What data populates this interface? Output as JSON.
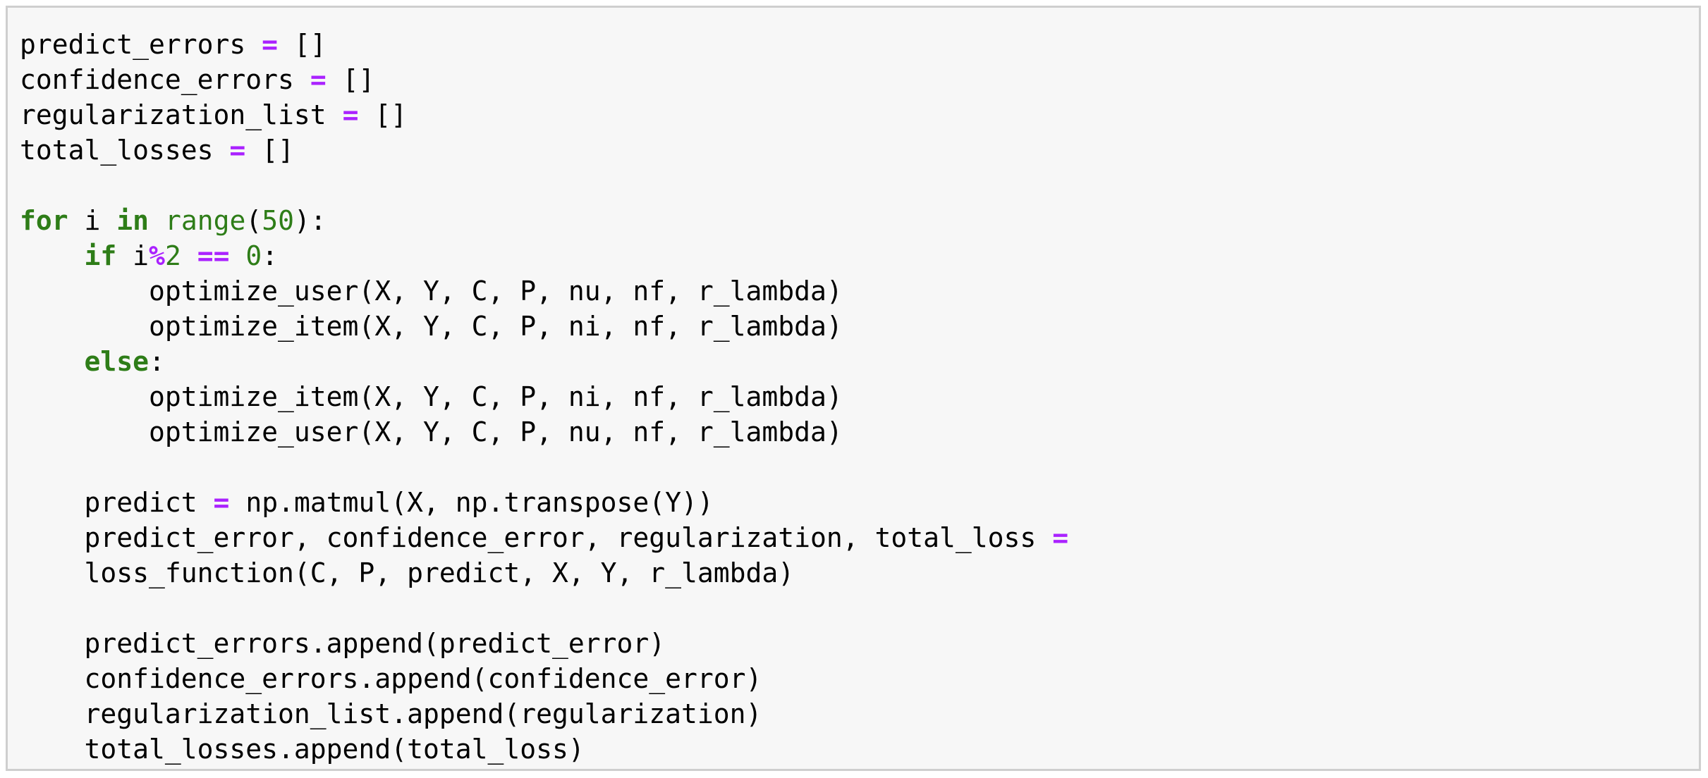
{
  "colors": {
    "keyword": "#2e7d18",
    "operator": "#aa22ff",
    "number": "#2e7d18",
    "builtin": "#2e7d18",
    "text": "#000000",
    "cell_background": "#f7f7f7",
    "cell_border": "#cfcfcf"
  },
  "code_lines": [
    [
      {
        "t": "plain",
        "v": "predict_errors "
      },
      {
        "t": "op",
        "v": "="
      },
      {
        "t": "plain",
        "v": " []"
      }
    ],
    [
      {
        "t": "plain",
        "v": "confidence_errors "
      },
      {
        "t": "op",
        "v": "="
      },
      {
        "t": "plain",
        "v": " []"
      }
    ],
    [
      {
        "t": "plain",
        "v": "regularization_list "
      },
      {
        "t": "op",
        "v": "="
      },
      {
        "t": "plain",
        "v": " []"
      }
    ],
    [
      {
        "t": "plain",
        "v": "total_losses "
      },
      {
        "t": "op",
        "v": "="
      },
      {
        "t": "plain",
        "v": " []"
      }
    ],
    [],
    [
      {
        "t": "kw",
        "v": "for"
      },
      {
        "t": "plain",
        "v": " i "
      },
      {
        "t": "kw",
        "v": "in"
      },
      {
        "t": "plain",
        "v": " "
      },
      {
        "t": "bi",
        "v": "range"
      },
      {
        "t": "plain",
        "v": "("
      },
      {
        "t": "num",
        "v": "50"
      },
      {
        "t": "plain",
        "v": "):"
      }
    ],
    [
      {
        "t": "plain",
        "v": "    "
      },
      {
        "t": "kw",
        "v": "if"
      },
      {
        "t": "plain",
        "v": " i"
      },
      {
        "t": "op",
        "v": "%"
      },
      {
        "t": "num",
        "v": "2"
      },
      {
        "t": "plain",
        "v": " "
      },
      {
        "t": "op",
        "v": "=="
      },
      {
        "t": "plain",
        "v": " "
      },
      {
        "t": "num",
        "v": "0"
      },
      {
        "t": "plain",
        "v": ":"
      }
    ],
    [
      {
        "t": "plain",
        "v": "        optimize_user(X, Y, C, P, nu, nf, r_lambda)"
      }
    ],
    [
      {
        "t": "plain",
        "v": "        optimize_item(X, Y, C, P, ni, nf, r_lambda)"
      }
    ],
    [
      {
        "t": "plain",
        "v": "    "
      },
      {
        "t": "kw",
        "v": "else"
      },
      {
        "t": "plain",
        "v": ":"
      }
    ],
    [
      {
        "t": "plain",
        "v": "        optimize_item(X, Y, C, P, ni, nf, r_lambda)"
      }
    ],
    [
      {
        "t": "plain",
        "v": "        optimize_user(X, Y, C, P, nu, nf, r_lambda)"
      }
    ],
    [],
    [
      {
        "t": "plain",
        "v": "    predict "
      },
      {
        "t": "op",
        "v": "="
      },
      {
        "t": "plain",
        "v": " np.matmul(X, np.transpose(Y))"
      }
    ],
    [
      {
        "t": "plain",
        "v": "    predict_error, confidence_error, regularization, total_loss "
      },
      {
        "t": "op",
        "v": "="
      }
    ],
    [
      {
        "t": "plain",
        "v": "    loss_function(C, P, predict, X, Y, r_lambda)"
      }
    ],
    [],
    [
      {
        "t": "plain",
        "v": "    predict_errors.append(predict_error)"
      }
    ],
    [
      {
        "t": "plain",
        "v": "    confidence_errors.append(confidence_error)"
      }
    ],
    [
      {
        "t": "plain",
        "v": "    regularization_list.append(regularization)"
      }
    ],
    [
      {
        "t": "plain",
        "v": "    total_losses.append(total_loss)"
      }
    ]
  ]
}
